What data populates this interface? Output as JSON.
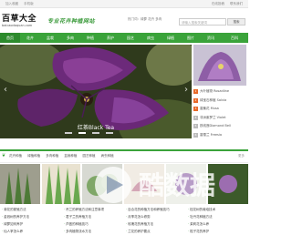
{
  "topbar": {
    "links": [
      "加入收藏",
      "手机版"
    ],
    "right": [
      "在线投稿",
      "联系我们"
    ]
  },
  "header": {
    "logo_name": "百草大全",
    "logo_url": "baicaodaquan.com",
    "slogan": "专业花卉种植网站",
    "hotwords": "热门词：绿萝 花卉 多肉",
    "search_placeholder": "请输入搜索关键词",
    "search_button": "搜索"
  },
  "nav": {
    "items": [
      "首页",
      "花卉",
      "盆栽",
      "多肉",
      "种植",
      "养护",
      "园艺",
      "病虫",
      "绿植",
      "图片",
      "资讯",
      "百科"
    ],
    "active_index": 0
  },
  "slider": {
    "caption": "红茶Black Tea",
    "dot_count": 4,
    "active_dot": 1,
    "prev_icon": "chevron-left-icon",
    "next_icon": "chevron-right-icon"
  },
  "sidebar": {
    "ranking": [
      {
        "num": "1",
        "title": "大叶植物 Rosadline"
      },
      {
        "num": "2",
        "title": "绿宝石种植 Salvia"
      },
      {
        "num": "3",
        "title": "香蕉花 Musa"
      },
      {
        "num": "4",
        "title": "非洲紫罗兰 Violet"
      },
      {
        "num": "5",
        "title": "铁线莲Diamond Bell"
      },
      {
        "num": "6",
        "title": "香雪兰 Freesia"
      }
    ]
  },
  "section": {
    "tabs": [
      "花卉种植",
      "绿植种植",
      "多肉种植",
      "盆栽种植",
      "园艺种植",
      "病虫种植"
    ],
    "more": "更多"
  },
  "lists": [
    [
      "菊花的繁殖方法",
      "金钱树的养护方法",
      "绿萝如何养护",
      "仙人掌怎么养"
    ],
    [
      "吊兰的养殖方法和注意事项",
      "君子兰的养殖方法",
      "芦荟的种植技巧",
      "多肉植物浇水方法"
    ],
    [
      "百合花的种植方法和养殖技巧",
      "月季花怎么修剪",
      "玫瑰花的养殖方法",
      "兰花的养护要点"
    ],
    [
      "桂花树的栽培技术",
      "牡丹花种植方法",
      "茉莉花怎么养",
      "栀子花的养护"
    ]
  ]
}
